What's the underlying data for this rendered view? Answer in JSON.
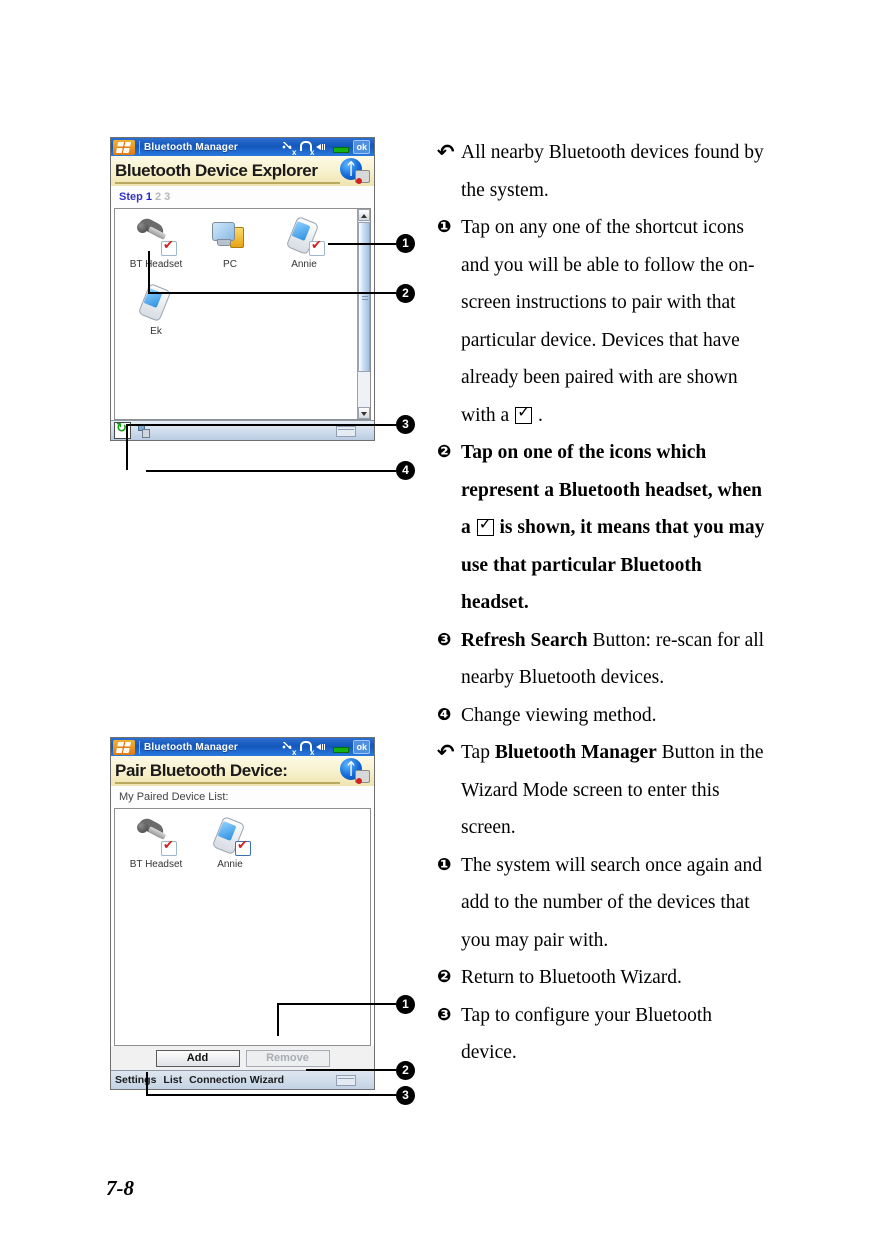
{
  "page": {
    "number": "7-8"
  },
  "screens": {
    "explorer": {
      "titlebar": {
        "app_title": "Bluetooth Manager",
        "ok_label": "ok",
        "icons": [
          "connectivity-icon",
          "signal-icon",
          "speaker-icon",
          "battery-icon"
        ]
      },
      "header_title": "Bluetooth Device Explorer",
      "step": {
        "label": "Step",
        "numbers": [
          "1",
          "2",
          "3"
        ],
        "active": "1"
      },
      "devices": [
        {
          "name": "BT Headset",
          "icon": "headset-icon",
          "paired": true
        },
        {
          "name": "PC",
          "icon": "pc-icon",
          "paired": false
        },
        {
          "name": "Annie",
          "icon": "pda-icon",
          "paired": true
        },
        {
          "name": "Ek",
          "icon": "pda-icon",
          "paired": false
        }
      ],
      "taskbar": {
        "refresh": "refresh-search-icon",
        "viewmode": "change-view-icon"
      }
    },
    "pair": {
      "titlebar": {
        "app_title": "Bluetooth Manager",
        "ok_label": "ok",
        "icons": [
          "connectivity-icon",
          "signal-icon",
          "speaker-icon",
          "battery-icon"
        ]
      },
      "header_title": "Pair Bluetooth Device:",
      "list_label": "My Paired Device List:",
      "devices": [
        {
          "name": "BT Headset",
          "icon": "headset-icon",
          "paired": true
        },
        {
          "name": "Annie",
          "icon": "pda-icon",
          "paired": true
        }
      ],
      "buttons": {
        "add": "Add",
        "remove": "Remove"
      },
      "commandbar": {
        "settings": "Settings",
        "list": "List",
        "connection_wizard": "Connection Wizard"
      }
    }
  },
  "callouts": {
    "explorer": [
      "1",
      "2",
      "3",
      "4"
    ],
    "pair": [
      "1",
      "2",
      "3"
    ]
  },
  "instructions_top": [
    {
      "marker": "↶",
      "marker_type": "back-arrow",
      "bold": false,
      "parts": [
        {
          "t": "All nearby Bluetooth devices found by the system."
        }
      ]
    },
    {
      "marker": "❶",
      "marker_type": "number-1",
      "bold": false,
      "parts": [
        {
          "t": "Tap on any one of the shortcut icons and you will be able to follow the on-screen instructions to pair with that particular device. Devices that have already been paired with are shown with a "
        },
        {
          "checkbox": true
        },
        {
          "t": " ."
        }
      ]
    },
    {
      "marker": "❷",
      "marker_type": "number-2",
      "bold": true,
      "parts": [
        {
          "t": "Tap on one of the icons which represent a Bluetooth headset, when a "
        },
        {
          "checkbox": true
        },
        {
          "t": " is shown, it means that you may use that particular Bluetooth headset."
        }
      ]
    },
    {
      "marker": "❸",
      "marker_type": "number-3",
      "bold": false,
      "parts": [
        {
          "t": "Refresh Search",
          "b": true
        },
        {
          "t": " Button: re-scan for all nearby Bluetooth devices."
        }
      ]
    },
    {
      "marker": "❹",
      "marker_type": "number-4",
      "bold": false,
      "parts": [
        {
          "t": "Change viewing method."
        }
      ]
    }
  ],
  "instructions_bottom": [
    {
      "marker": "↶",
      "marker_type": "back-arrow",
      "bold": false,
      "parts": [
        {
          "t": "Tap "
        },
        {
          "t": "Bluetooth Manager",
          "b": true
        },
        {
          "t": " Button in the Wizard Mode screen to enter this screen."
        }
      ]
    },
    {
      "marker": "❶",
      "marker_type": "number-1",
      "bold": false,
      "parts": [
        {
          "t": "The system will search once again and add to the number of the devices that you may pair with."
        }
      ]
    },
    {
      "marker": "❷",
      "marker_type": "number-2",
      "bold": false,
      "parts": [
        {
          "t": "Return to Bluetooth Wizard."
        }
      ]
    },
    {
      "marker": "❸",
      "marker_type": "number-3",
      "bold": false,
      "parts": [
        {
          "t": "Tap to configure your Bluetooth device."
        }
      ]
    }
  ]
}
